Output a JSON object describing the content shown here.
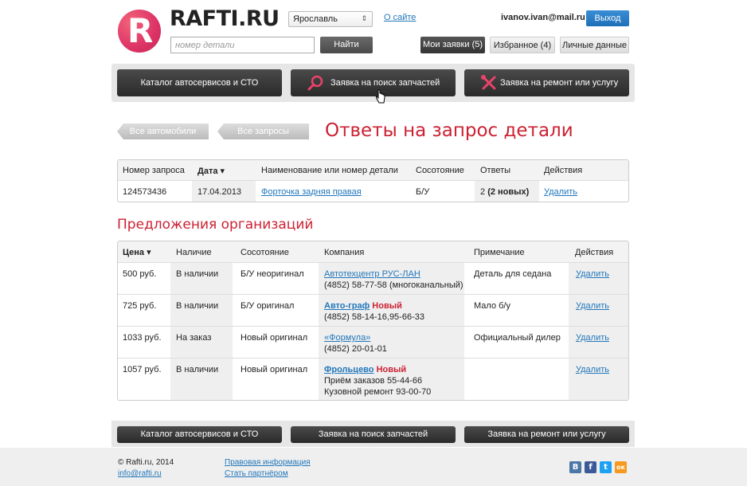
{
  "header": {
    "logo_letter": "R",
    "logo_text": "RAFTI.RU",
    "city": "Ярославль",
    "about_link": "О сайте",
    "search_placeholder": "номер детали",
    "search_button": "Найти",
    "user_email": "ivanov.ivan@mail.ru",
    "logout": "Выход",
    "tabs": {
      "my_orders": "Мои заявки (5)",
      "favorites": "Избранное (4)",
      "personal": "Личные данные"
    }
  },
  "nav": {
    "catalog": "Каталог автосервисов и СТО",
    "parts_request": "Заявка на поиск запчастей",
    "repair_request": "Заявка на ремонт или услугу"
  },
  "breadcrumbs": {
    "all_cars": "Все автомобили",
    "all_requests": "Все запросы"
  },
  "page_title": "Ответы на запрос детали",
  "request_table": {
    "headers": {
      "number": "Номер запроса",
      "date": "Дата",
      "name": "Наименование или номер детали",
      "condition": "Сосотояние",
      "answers": "Ответы",
      "actions": "Действия"
    },
    "row": {
      "number": "124573436",
      "date": "17.04.2013",
      "name": "Форточка задняя правая",
      "condition": "Б/У",
      "answers_count": "2",
      "answers_new": "(2 новых)",
      "action": "Удалить"
    }
  },
  "offers_title": "Предложения организаций",
  "offers_table": {
    "headers": {
      "price": "Цена",
      "availability": "Наличие",
      "condition": "Сосотояние",
      "company": "Компания",
      "note": "Примечание",
      "actions": "Действия"
    },
    "rows": [
      {
        "price": "500 руб.",
        "availability": "В наличии",
        "condition": "Б/У неоригинал",
        "company": "Автотехцентр РУС-ЛАН",
        "is_new": "",
        "phone": "(4852) 58-77-58 (многоканальный)",
        "note": "Деталь для седана",
        "action": "Удалить"
      },
      {
        "price": "725 руб.",
        "availability": "В наличии",
        "condition": "Б/У оригинал",
        "company": "Авто-граф",
        "is_new": "Новый",
        "phone": "(4852) 58-14-16,95-66-33",
        "note": "Мало б/у",
        "action": "Удалить"
      },
      {
        "price": "1033 руб.",
        "availability": "На заказ",
        "condition": "Новый оригинал",
        "company": "«Формула»",
        "is_new": "",
        "phone": "(4852) 20-01-01",
        "note": "Официальный дилер",
        "action": "Удалить"
      },
      {
        "price": "1057 руб.",
        "availability": "В наличии",
        "condition": "Новый оригинал",
        "company": "Фрольцево",
        "is_new": "Новый",
        "phone": "Приём заказов 55-44-66 Кузовной ремонт 93-00-70",
        "note": "",
        "action": "Удалить"
      }
    ]
  },
  "footer": {
    "copyright": "© Rafti.ru, 2014",
    "email": "info@rafti.ru",
    "legal": "Правовая информация",
    "partner": "Стать партнёром",
    "social": {
      "vk": "В",
      "fb": "f",
      "tw": "t",
      "ok": "ок"
    }
  },
  "colors": {
    "accent": "#cc2233",
    "link": "#2277bb",
    "logout": "#1f6fb8",
    "social_vk": "#4a76a8",
    "social_fb": "#3b5998",
    "social_tw": "#1da1f2",
    "social_ok": "#f59a1e"
  }
}
